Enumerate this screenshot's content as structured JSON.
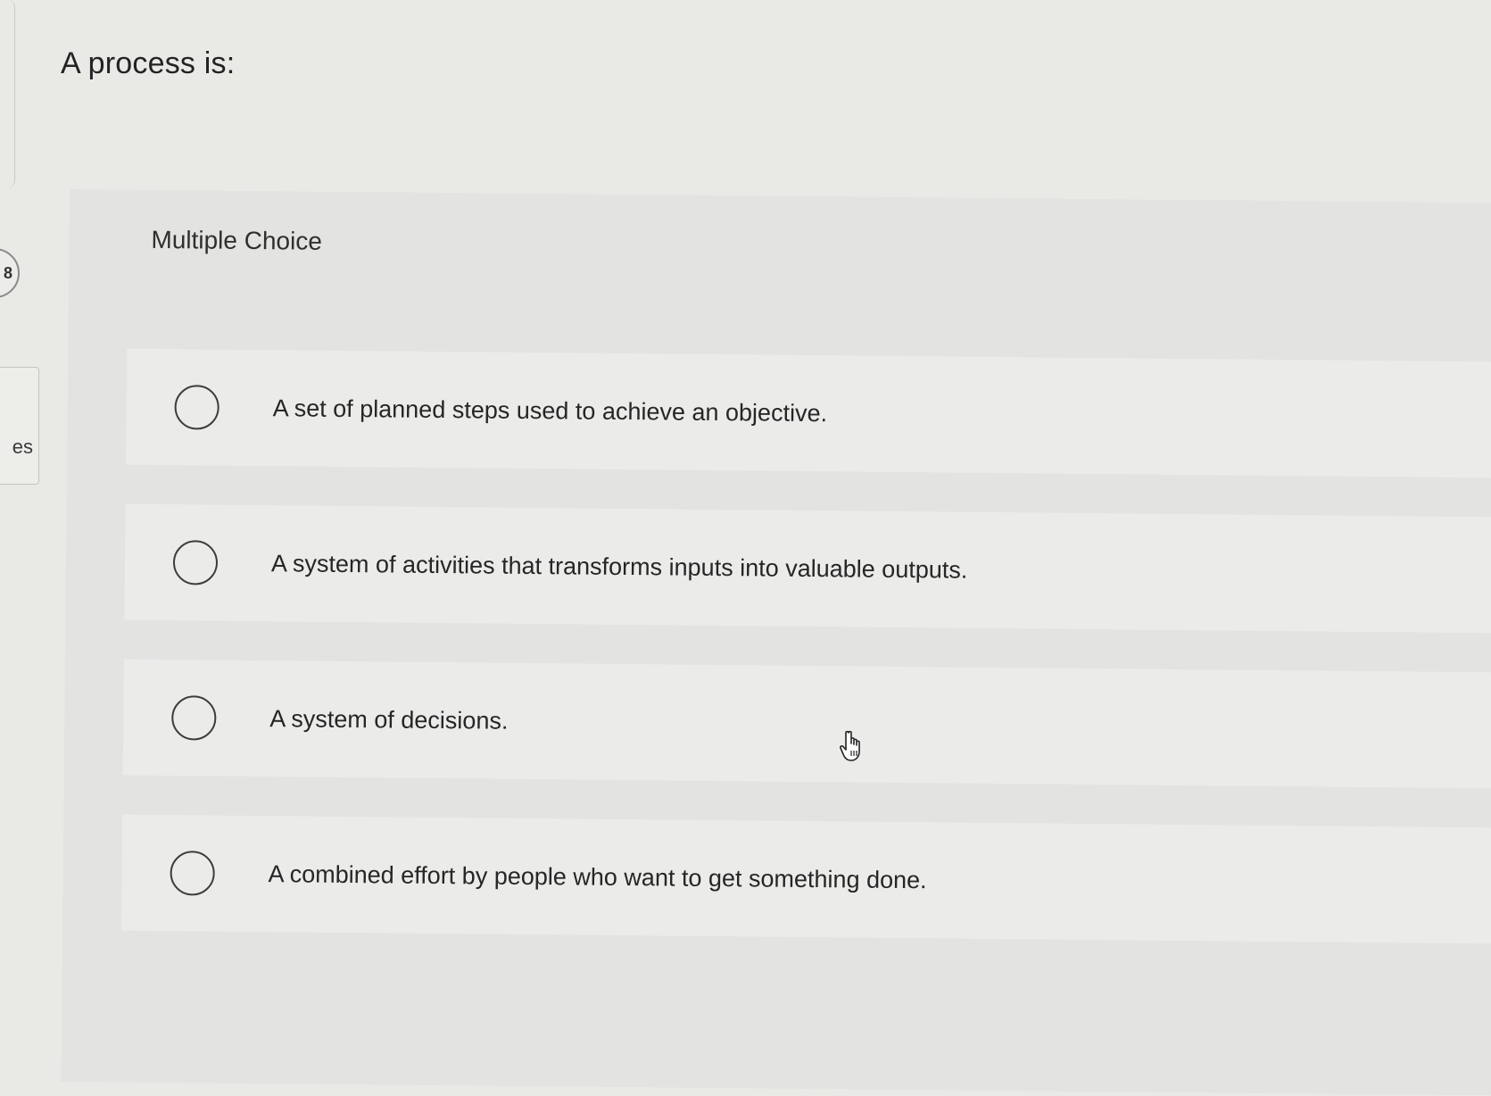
{
  "sidebar": {
    "question_number": "8",
    "tab_label": "es"
  },
  "question": {
    "title": "A process is:",
    "type_label": "Multiple Choice",
    "options": [
      {
        "label": "A set of planned steps used to achieve an objective.",
        "selected": false
      },
      {
        "label": "A system of activities that transforms inputs into valuable outputs.",
        "selected": false
      },
      {
        "label": "A system of decisions.",
        "selected": false
      },
      {
        "label": "A combined effort by people who want to get something done.",
        "selected": false
      }
    ]
  },
  "cursor": {
    "icon": "hand-pointer-icon"
  }
}
